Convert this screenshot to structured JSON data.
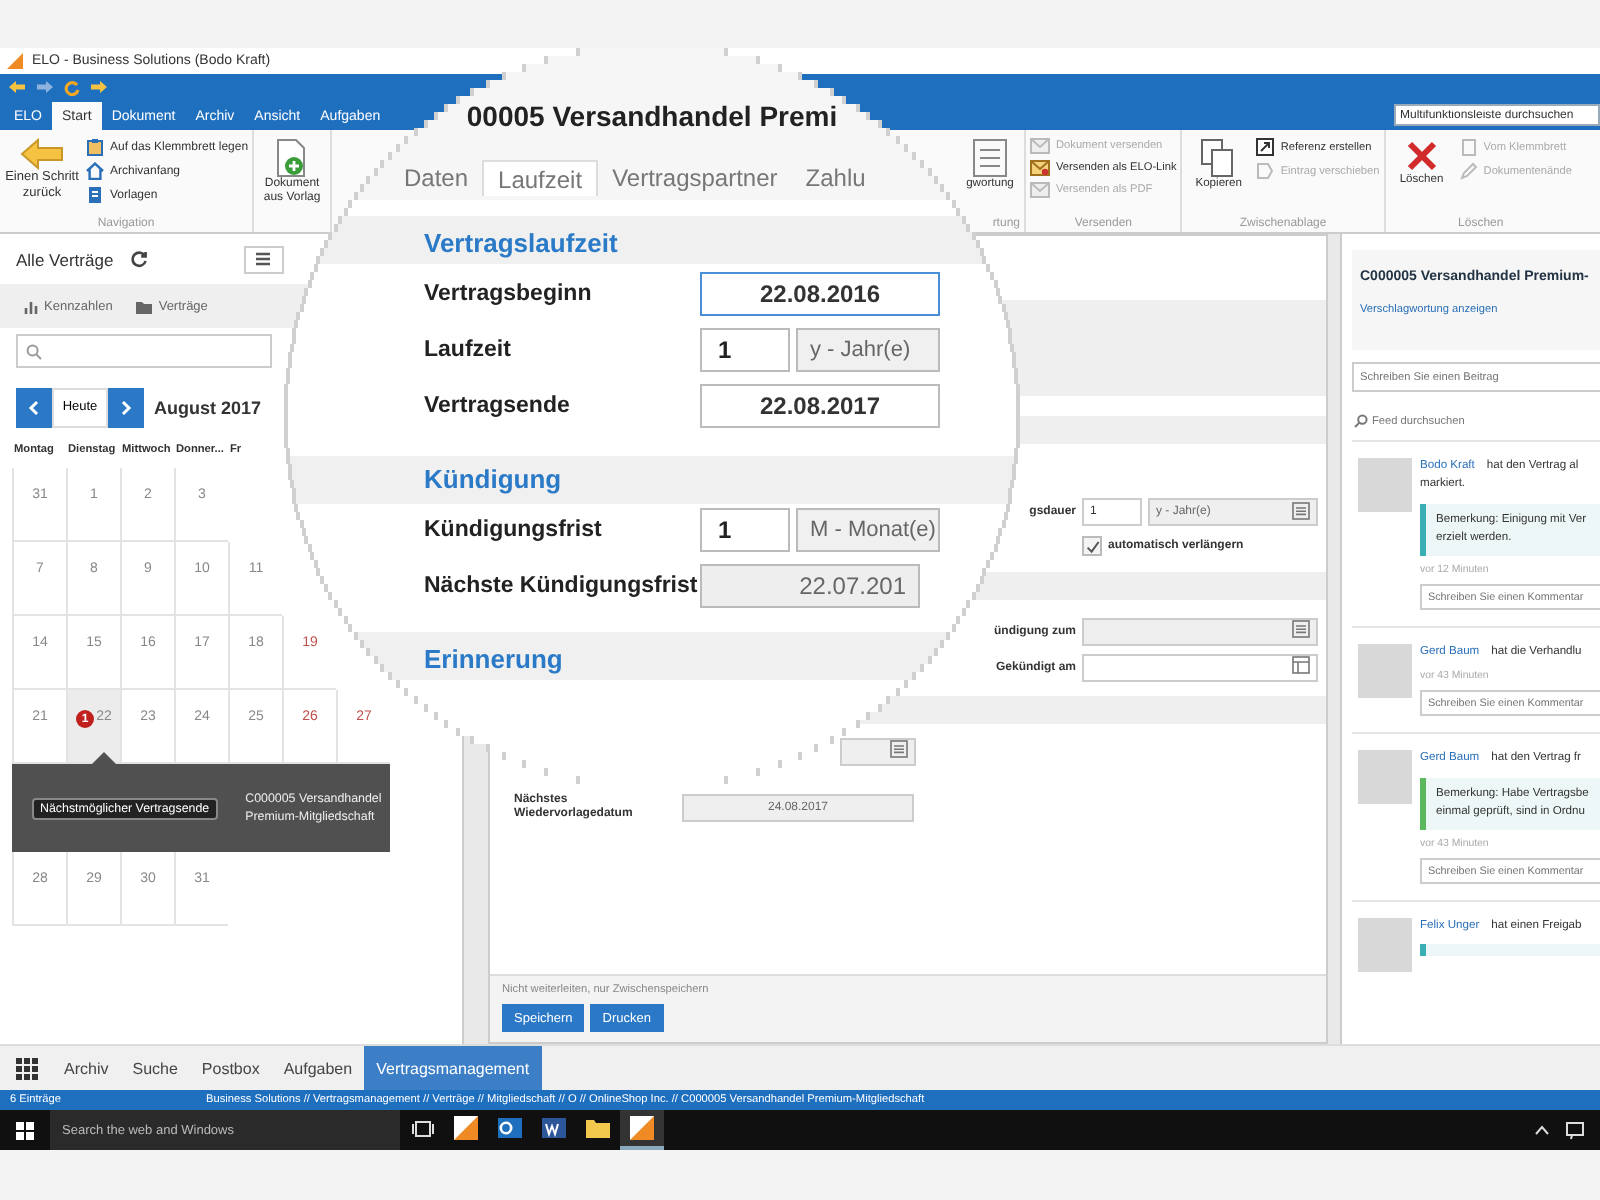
{
  "window": {
    "title": "ELO - Business Solutions (Bodo Kraft)"
  },
  "ribbon_tabs": [
    {
      "label": "ELO",
      "selected": false
    },
    {
      "label": "Start",
      "selected": true
    },
    {
      "label": "Dokument",
      "selected": false
    },
    {
      "label": "Archiv",
      "selected": false
    },
    {
      "label": "Ansicht",
      "selected": false
    },
    {
      "label": "Aufgaben",
      "selected": false
    }
  ],
  "ribbon_search": {
    "placeholder": "Multifunktionsleiste durchsuchen"
  },
  "ribbon": {
    "left_groups": [
      {
        "label": "Navigation",
        "items": [
          {
            "kind": "large",
            "label": "Einen Schritt zurück",
            "disabled": false
          },
          {
            "kind": "small",
            "label": "Auf das Klemmbrett legen",
            "disabled": false
          },
          {
            "kind": "small",
            "label": "Archivanfang",
            "disabled": false
          },
          {
            "kind": "small",
            "label": "Vorlagen",
            "disabled": false
          }
        ]
      },
      {
        "items": [
          {
            "kind": "large",
            "label": "Dokument aus Vorlag",
            "disabled": false
          }
        ]
      }
    ],
    "right_groups": [
      {
        "label": "rtung",
        "items": [
          {
            "kind": "large",
            "label": "gwortung",
            "disabled": false
          }
        ]
      },
      {
        "label": "Versenden",
        "items": [
          {
            "kind": "small",
            "label": "Dokument versenden",
            "disabled": true
          },
          {
            "kind": "small",
            "label": "Versenden als ELO-Link",
            "disabled": false
          },
          {
            "kind": "small",
            "label": "Versenden als PDF",
            "disabled": true
          }
        ]
      },
      {
        "label": "Zwischenablage",
        "items": [
          {
            "kind": "large",
            "label": "Kopieren",
            "disabled": false
          },
          {
            "kind": "small",
            "label": "Referenz erstellen",
            "disabled": false
          },
          {
            "kind": "small",
            "label": "Eintrag verschieben",
            "disabled": true
          }
        ]
      },
      {
        "label": "Löschen",
        "items": [
          {
            "kind": "large",
            "label": "Löschen",
            "disabled": false
          },
          {
            "kind": "small",
            "label": "Vom Klemmbrett",
            "disabled": true
          },
          {
            "kind": "small",
            "label": "Dokumentenände",
            "disabled": true
          }
        ]
      }
    ]
  },
  "list_panel": {
    "title": "Alle Verträge",
    "toolbar": [
      "Kennzahlen",
      "Verträge"
    ]
  },
  "calendar": {
    "today_button": "Heute",
    "month": "August 2017",
    "weekdays": [
      "Montag",
      "Dienstag",
      "Mittwoch",
      "Donner...",
      "Fr"
    ],
    "weeks": [
      [
        {
          "day": "31",
          "weekend": false,
          "selected": false
        },
        {
          "day": "1",
          "weekend": false,
          "selected": false
        },
        {
          "day": "2",
          "weekend": false,
          "selected": false
        },
        {
          "day": "3",
          "weekend": false,
          "selected": false
        }
      ],
      [
        {
          "day": "7",
          "weekend": false,
          "selected": false
        },
        {
          "day": "8",
          "weekend": false,
          "selected": false
        },
        {
          "day": "9",
          "weekend": false,
          "selected": false
        },
        {
          "day": "10",
          "weekend": false,
          "selected": false
        },
        {
          "day": "11",
          "weekend": false,
          "selected": false
        }
      ],
      [
        {
          "day": "14",
          "weekend": false,
          "selected": false
        },
        {
          "day": "15",
          "weekend": false,
          "selected": false
        },
        {
          "day": "16",
          "weekend": false,
          "selected": false
        },
        {
          "day": "17",
          "weekend": false,
          "selected": false
        },
        {
          "day": "18",
          "weekend": false,
          "selected": false
        },
        {
          "day": "19",
          "weekend": true,
          "selected": false
        }
      ],
      [
        {
          "day": "21",
          "weekend": false,
          "selected": false
        },
        {
          "day": "22",
          "weekend": false,
          "selected": true,
          "badge": "1"
        },
        {
          "day": "23",
          "weekend": false,
          "selected": false
        },
        {
          "day": "24",
          "weekend": false,
          "selected": false
        },
        {
          "day": "25",
          "weekend": false,
          "selected": false
        },
        {
          "day": "26",
          "weekend": true,
          "selected": false
        },
        {
          "day": "27",
          "weekend": true,
          "selected": false
        }
      ],
      [
        {
          "day": "28",
          "weekend": false,
          "selected": false
        },
        {
          "day": "29",
          "weekend": false,
          "selected": false
        },
        {
          "day": "30",
          "weekend": false,
          "selected": false
        },
        {
          "day": "31",
          "weekend": false,
          "selected": false
        }
      ]
    ],
    "tooltip": {
      "tag": "Nächstmöglicher Vertragsende",
      "text": "C000005 Versandhandel Premium-Mitgliedschaft"
    }
  },
  "form": {
    "duration": {
      "label": "gsdauer",
      "value": "1",
      "unit": "y - Jahr(e)"
    },
    "auto_renew": {
      "label": "automatisch verlängern",
      "checked": true
    },
    "cancel_to": {
      "label": "ündigung zum"
    },
    "cancelled_on": {
      "label": "Gekündigt am"
    },
    "next_resubmission": {
      "label": "Nächstes Wiedervorlagedatum",
      "value": "24.08.2017"
    },
    "footer_note": "Nicht weiterleiten, nur Zwischenspeichern",
    "buttons": [
      "Speichern",
      "Drucken"
    ]
  },
  "lens": {
    "title": "00005 Versandhandel Premi",
    "tabs": [
      {
        "label": "Daten",
        "selected": false
      },
      {
        "label": "Laufzeit",
        "selected": true
      },
      {
        "label": "Vertragspartner",
        "selected": false
      },
      {
        "label": "Zahlu",
        "selected": false
      }
    ],
    "sections": [
      {
        "heading": "Vertragslaufzeit",
        "rows": [
          {
            "kind": "date",
            "label": "Vertragsbeginn",
            "value": "22.08.2016",
            "focused": true
          },
          {
            "kind": "period",
            "label": "Laufzeit",
            "value": "1",
            "unit": "y - Jahr(e)",
            "focused": false
          },
          {
            "kind": "date",
            "label": "Vertragsende",
            "value": "22.08.2017",
            "focused": false
          }
        ]
      },
      {
        "heading": "Kündigung",
        "rows": [
          {
            "kind": "period",
            "label": "Kündigungsfrist",
            "value": "1",
            "unit": "M - Monat(e)",
            "focused": false
          },
          {
            "kind": "readonly",
            "label": "Nächste Kündigungsfrist",
            "value": "22.07.201",
            "focused": false
          }
        ]
      },
      {
        "heading": "Erinnerung"
      }
    ]
  },
  "feed": {
    "title": "C000005 Versandhandel Premium-",
    "link": "Verschlagwortung anzeigen",
    "post_placeholder": "Schreiben Sie einen Beitrag",
    "search": "Feed durchsuchen",
    "entries": [
      {
        "author": "Bodo Kraft",
        "action": [
          "hat den Vertrag al",
          "markiert."
        ],
        "note": {
          "lines": [
            "Bemerkung: Einigung mit Ver",
            "erzielt werden."
          ],
          "color": "#3aaeb3"
        },
        "time": "vor 12 Minuten",
        "comment_placeholder": "Schreiben Sie einen Kommentar"
      },
      {
        "author": "Gerd Baum",
        "action": [
          "hat die Verhandlu"
        ],
        "time": "vor 43 Minuten",
        "comment_placeholder": "Schreiben Sie einen Kommentar"
      },
      {
        "author": "Gerd Baum",
        "action": [
          "hat den Vertrag fr"
        ],
        "note": {
          "lines": [
            "Bemerkung: Habe Vertragsbe",
            "einmal geprüft, sind in Ordnu"
          ],
          "color": "#5cb85c"
        },
        "time": "vor 43 Minuten",
        "comment_placeholder": "Schreiben Sie einen Kommentar"
      },
      {
        "author": "Felix Unger",
        "action": [
          "hat einen Freigab"
        ],
        "note": {
          "color": "#3aaeb3"
        }
      }
    ]
  },
  "bottom_tabs": [
    {
      "label": "Archiv",
      "selected": false
    },
    {
      "label": "Suche",
      "selected": false
    },
    {
      "label": "Postbox",
      "selected": false
    },
    {
      "label": "Aufgaben",
      "selected": false
    },
    {
      "label": "Vertragsmanagement",
      "selected": true
    }
  ],
  "status_bar": {
    "count": "6 Einträge",
    "path": "Business Solutions // Vertragsmanagement // Verträge // Mitgliedschaft // O // OnlineShop Inc. // C000005 Versandhandel Premium-Mitgliedschaft"
  },
  "taskbar": {
    "search_placeholder": "Search the web and Windows",
    "apps": [
      {
        "selected": false
      },
      {
        "selected": false
      },
      {
        "selected": false
      },
      {
        "selected": false
      },
      {
        "selected": true
      }
    ]
  }
}
